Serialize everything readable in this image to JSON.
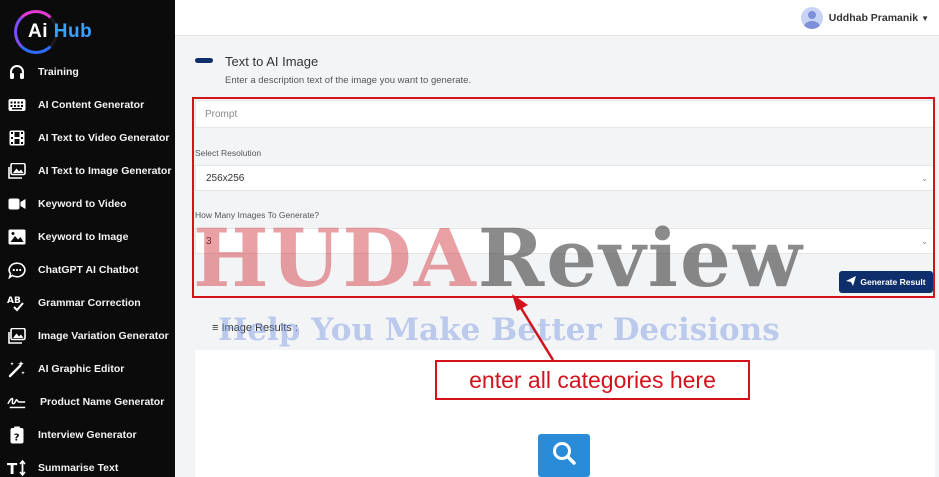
{
  "app": {
    "logo_ai": "Ai",
    "logo_hub": "Hub"
  },
  "sidebar": {
    "items": [
      {
        "label": "Training",
        "icon": "headset-icon"
      },
      {
        "label": "AI Content Generator",
        "icon": "keyboard-icon"
      },
      {
        "label": "AI Text to Video Generator",
        "icon": "film-icon"
      },
      {
        "label": "AI Text to Image Generator",
        "icon": "image-gallery-icon"
      },
      {
        "label": "Keyword to Video",
        "icon": "video-camera-icon"
      },
      {
        "label": "Keyword to Image",
        "icon": "image-icon"
      },
      {
        "label": "ChatGPT AI Chatbot",
        "icon": "chat-bubble-icon"
      },
      {
        "label": "Grammar Correction",
        "icon": "spellcheck-icon"
      },
      {
        "label": "Image Variation Generator",
        "icon": "image-gallery-icon"
      },
      {
        "label": "AI Graphic Editor",
        "icon": "magic-wand-icon"
      },
      {
        "label": "Product Name Generator",
        "icon": "signature-icon"
      },
      {
        "label": "Interview Generator",
        "icon": "clipboard-question-icon"
      },
      {
        "label": "Summarise Text",
        "icon": "text-height-icon"
      }
    ]
  },
  "header": {
    "user_name": "Uddhab Pramanik"
  },
  "main": {
    "title": "Text to AI Image",
    "subtitle": "Enter a description text of the image you want to generate.",
    "prompt_placeholder": "Prompt",
    "resolution_label": "Select Resolution",
    "resolution_value": "256x256",
    "count_label": "How Many Images To Generate?",
    "count_value": "3",
    "generate_button": "Generate Result",
    "results_label": "≡ Image Results :"
  },
  "annotation": {
    "text": "enter all categories here"
  },
  "watermark": {
    "part1": "HUDA",
    "part2": "Review",
    "tagline": "Help You Make Better Decisions"
  },
  "colors": {
    "sidebar_bg": "#0b0b0c",
    "accent": "#0e2f6b",
    "annotation_red": "#d3121c",
    "search_blue": "#2a8bd8"
  }
}
